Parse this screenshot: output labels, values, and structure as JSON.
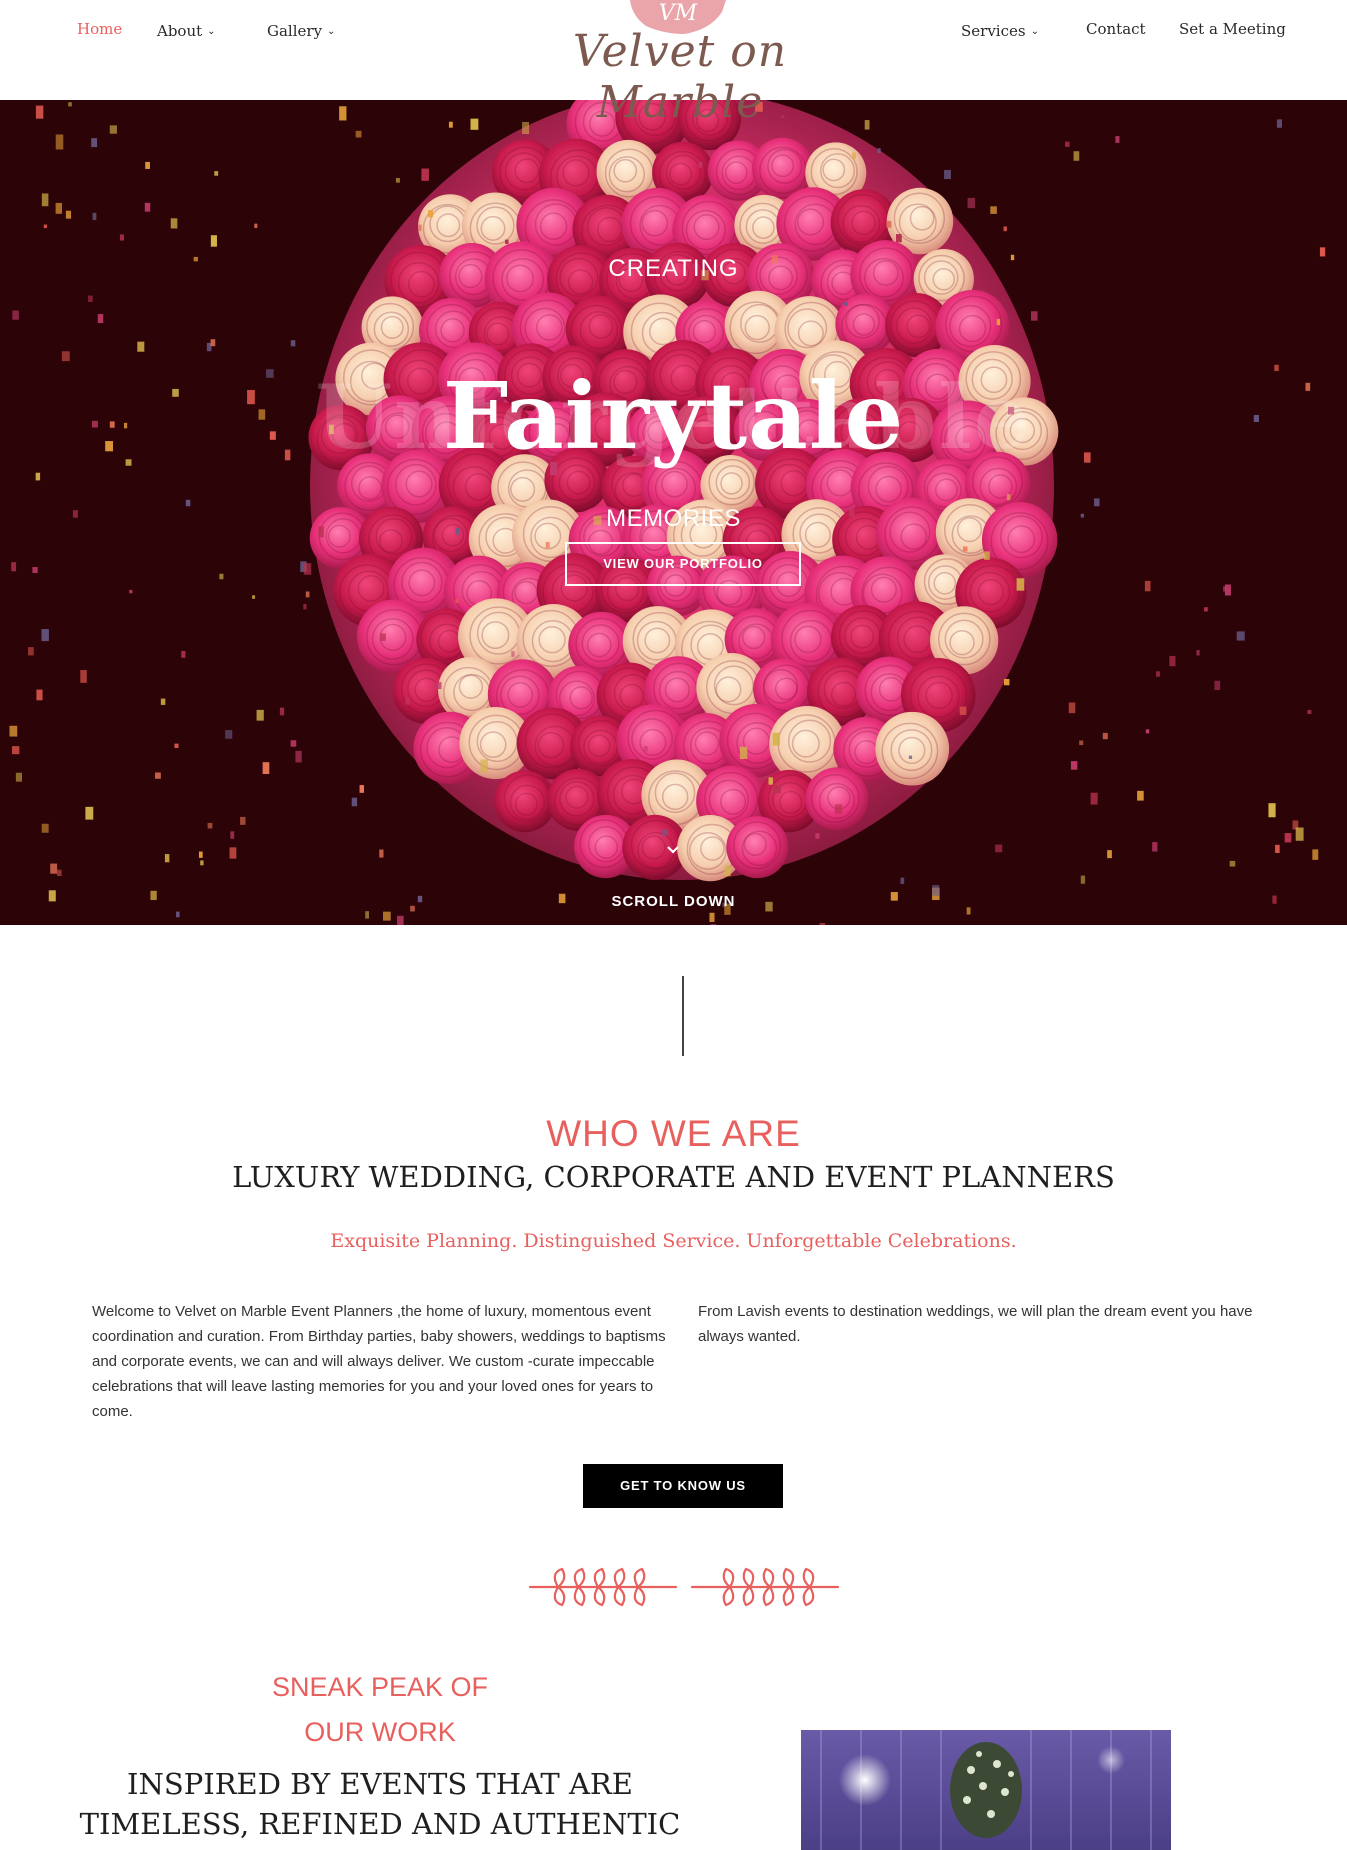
{
  "nav": {
    "home": "Home",
    "about": "About",
    "gallery": "Gallery",
    "services": "Services",
    "contact": "Contact",
    "meeting": "Set a Meeting",
    "chevron": "⌄"
  },
  "logo": {
    "mark": "VM",
    "name": "Velvet on Marble"
  },
  "hero": {
    "creating": "CREATING",
    "ghost_word": "Unforgettable",
    "main_word": "Fairytale",
    "memories": "MEMORIES",
    "portfolio_button": "VIEW OUR PORTFOLIO",
    "scroll_label": "SCROLL DOWN",
    "scroll_icon": "chevron-down-icon"
  },
  "about": {
    "heading": "WHO WE ARE",
    "subheading": "LUXURY WEDDING, CORPORATE AND EVENT PLANNERS",
    "tagline": "Exquisite Planning. Distinguished Service. Unforgettable Celebrations.",
    "left_text": "Welcome to Velvet on Marble Event Planners ,the home of luxury, momentous event coordination and curation. From Birthday parties, baby showers, weddings to baptisms and corporate events, we can and will always deliver. We custom -curate impeccable celebrations that will leave lasting memories for you and your loved ones for years to come.",
    "right_text": "From Lavish events to destination weddings, we will plan the dream event you have always wanted.",
    "button": "GET TO KNOW US",
    "divider_icon": "leaf-branch-divider-icon"
  },
  "work": {
    "line1": "SNEAK PEAK OF",
    "line2": "OUR WORK",
    "heading1": "INSPIRED BY EVENTS THAT ARE",
    "heading2": "TIMELESS, REFINED AND AUTHENTIC"
  },
  "colors": {
    "accent": "#e8605e",
    "hero_bg": "#2c0307",
    "logo": "#7d5a50"
  }
}
